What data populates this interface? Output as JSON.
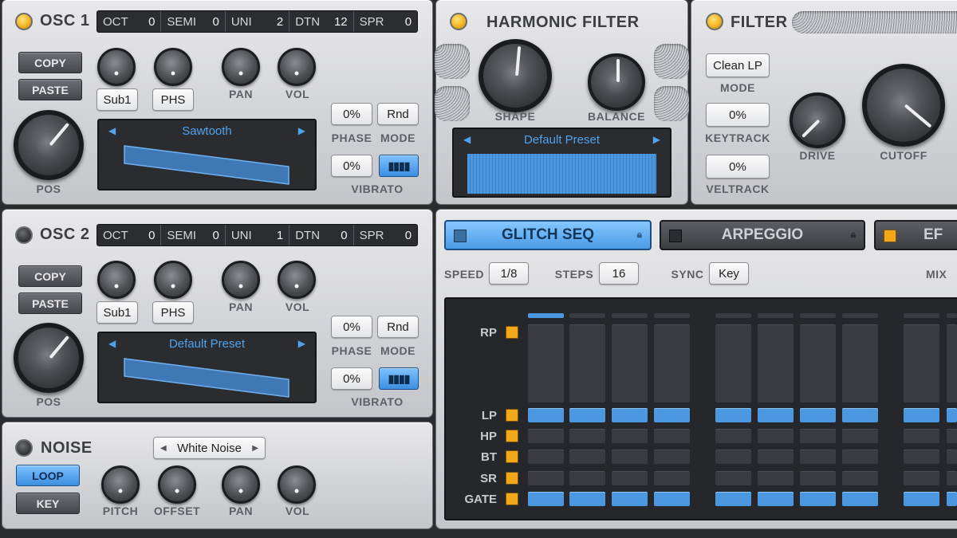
{
  "osc1": {
    "title": "OSC 1",
    "params": [
      {
        "label": "OCT",
        "value": "0"
      },
      {
        "label": "SEMI",
        "value": "0"
      },
      {
        "label": "UNI",
        "value": "2"
      },
      {
        "label": "DTN",
        "value": "12"
      },
      {
        "label": "SPR",
        "value": "0"
      }
    ],
    "copy": "COPY",
    "paste": "PASTE",
    "sub": "Sub1",
    "phs": "PHS",
    "pan": "PAN",
    "vol": "VOL",
    "pos": "POS",
    "wave": "Sawtooth",
    "phase_val": "0%",
    "phase": "PHASE",
    "mode_val": "Rnd",
    "mode": "MODE",
    "vibrato_val": "0%",
    "vibrato": "VIBRATO"
  },
  "osc2": {
    "title": "OSC 2",
    "params": [
      {
        "label": "OCT",
        "value": "0"
      },
      {
        "label": "SEMI",
        "value": "0"
      },
      {
        "label": "UNI",
        "value": "1"
      },
      {
        "label": "DTN",
        "value": "0"
      },
      {
        "label": "SPR",
        "value": "0"
      }
    ],
    "copy": "COPY",
    "paste": "PASTE",
    "sub": "Sub1",
    "phs": "PHS",
    "pan": "PAN",
    "vol": "VOL",
    "pos": "POS",
    "wave": "Default Preset",
    "phase_val": "0%",
    "phase": "PHASE",
    "mode_val": "Rnd",
    "mode": "MODE",
    "vibrato_val": "0%",
    "vibrato": "VIBRATO"
  },
  "noise": {
    "title": "NOISE",
    "type": "White Noise",
    "loop": "LOOP",
    "key": "KEY",
    "pitch": "PITCH",
    "offset": "OFFSET",
    "pan": "PAN",
    "vol": "VOL"
  },
  "harmonic": {
    "title": "HARMONIC FILTER",
    "shape": "SHAPE",
    "balance": "BALANCE",
    "preset": "Default Preset"
  },
  "filter": {
    "title": "FILTER",
    "mode_val": "Clean LP",
    "mode": "MODE",
    "keytrack_val": "0%",
    "keytrack": "KEYTRACK",
    "veltrack_val": "0%",
    "veltrack": "VELTRACK",
    "drive": "DRIVE",
    "cutoff": "CUTOFF"
  },
  "tabs": {
    "glitch": "GLITCH SEQ",
    "arp": "ARPEGGIO",
    "third": "EF"
  },
  "seq": {
    "speed": "SPEED",
    "speed_val": "1/8",
    "steps": "STEPS",
    "steps_val": "16",
    "sync": "SYNC",
    "sync_val": "Key",
    "mix": "MIX",
    "rows": [
      "RP",
      "LP",
      "HP",
      "BT",
      "SR",
      "GATE"
    ]
  },
  "colors": {
    "accent": "#4b98e0",
    "led_on": "#f0b21c",
    "step_square": "#f3a81a"
  }
}
